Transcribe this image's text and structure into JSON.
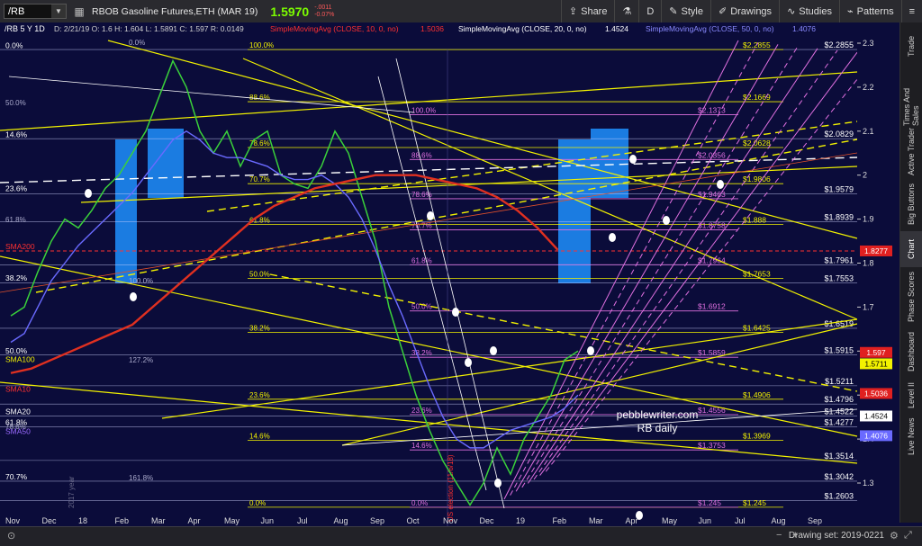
{
  "toolbar": {
    "symbol": "/RB",
    "instrument": "RBOB Gasoline Futures,ETH (MAR 19)",
    "price": "1.5970",
    "change_top": "-.0011",
    "change_bottom": "-0.07%",
    "share": "Share",
    "period": "D",
    "style": "Style",
    "drawings": "Drawings",
    "studies": "Studies",
    "patterns": "Patterns"
  },
  "chart": {
    "header_symbol": "/RB 5 Y 1D",
    "header_ohlc": "D: 2/21/19  O: 1.6  H: 1.604  L: 1.5891  C: 1.597  R: 0.0149",
    "sma10_label": "SimpleMovingAvg (CLOSE, 10, 0, no)",
    "sma10_val": "1.5036",
    "sma20_label": "SimpleMovingAvg (CLOSE, 20, 0, no)",
    "sma20_val": "1.4524",
    "sma50_label": "SimpleMovingAvg (CLOSE, 50, 0, no)",
    "sma50_val": "1.4076",
    "watermark_1": "pebblewriter.com",
    "watermark_2": "RB daily",
    "election": "US election (11/6/18)",
    "yr2017": "2017 year"
  },
  "y_axis": [
    "2.3",
    "2.2",
    "2.1",
    "2",
    "1.9",
    "1.8",
    "1.7",
    "1.6",
    "1.5",
    "1.4",
    "1.3"
  ],
  "x_axis": [
    "Nov",
    "Dec",
    "18",
    "Feb",
    "Mar",
    "Apr",
    "May",
    "Jun",
    "Jul",
    "Aug",
    "Sep",
    "Oct",
    "Nov",
    "Dec",
    "19",
    "Feb",
    "Mar",
    "Apr",
    "May",
    "Jun",
    "Jul",
    "Aug",
    "Sep"
  ],
  "price_tags": [
    {
      "label": "1.8277",
      "bg": "#e02020",
      "fg": "#ffffff",
      "y": 1.8277
    },
    {
      "label": "1.597",
      "bg": "#e02020",
      "fg": "#ffffff",
      "y": 1.597
    },
    {
      "label": "1.5711",
      "bg": "#f2f200",
      "fg": "#000000",
      "y": 1.5711
    },
    {
      "label": "1.5036",
      "bg": "#e02020",
      "fg": "#ffffff",
      "y": 1.5036
    },
    {
      "label": "1.4524",
      "bg": "#ffffff",
      "fg": "#000000",
      "y": 1.4524
    },
    {
      "label": "1.4076",
      "bg": "#6a6aff",
      "fg": "#ffffff",
      "y": 1.4076
    }
  ],
  "left_labels": [
    {
      "text": "0.0%",
      "color": "#ffffff",
      "y": 2.285
    },
    {
      "text": "14.6%",
      "color": "#ffffff",
      "y": 2.082
    },
    {
      "text": "23.6%",
      "color": "#ffffff",
      "y": 1.96
    },
    {
      "text": "SMA200",
      "color": "#ff3030",
      "y": 1.8277
    },
    {
      "text": "38.2%",
      "color": "#ffffff",
      "y": 1.756
    },
    {
      "text": "50.0%",
      "color": "#ffffff",
      "y": 1.59
    },
    {
      "text": "SMA100",
      "color": "#f2f200",
      "y": 1.5711
    },
    {
      "text": "SMA10",
      "color": "#ff3030",
      "y": 1.5036
    },
    {
      "text": "SMA20",
      "color": "#ffffff",
      "y": 1.4524
    },
    {
      "text": "61.8%",
      "color": "#ffffff",
      "y": 1.4277
    },
    {
      "text": "SMA50",
      "color": "#9a6aff",
      "y": 1.4076
    },
    {
      "text": "70.7%",
      "color": "#ffffff",
      "y": 1.3042
    }
  ],
  "fib_white": [
    {
      "pct": "0.0%",
      "val": "$2.2855",
      "y": 2.2855
    },
    {
      "pct": "14.6%",
      "val": "$2.0829",
      "y": 2.0829
    },
    {
      "pct": "23.6%",
      "val": "$1.9579",
      "y": 1.9579
    },
    {
      "pct": "",
      "val": "$1.8939",
      "y": 1.8939
    },
    {
      "pct": "",
      "val": "$1.7961",
      "y": 1.7961
    },
    {
      "pct": "",
      "val": "$1.7553",
      "y": 1.7553
    },
    {
      "pct": "",
      "val": "$1.6519",
      "y": 1.6519
    },
    {
      "pct": "",
      "val": "$1.5915",
      "y": 1.5915
    },
    {
      "pct": "",
      "val": "$1.5211",
      "y": 1.5211
    },
    {
      "pct": "",
      "val": "$1.4796",
      "y": 1.4796
    },
    {
      "pct": "",
      "val": "$1.4522",
      "y": 1.4522
    },
    {
      "pct": "",
      "val": "$1.4277",
      "y": 1.4277
    },
    {
      "pct": "",
      "val": "$1.3514",
      "y": 1.3514
    },
    {
      "pct": "",
      "val": "$1.3042",
      "y": 1.3042
    },
    {
      "pct": "",
      "val": "$1.2603",
      "y": 1.2603
    }
  ],
  "fib_yellow": [
    {
      "pct": "100.0%",
      "val": "$2.2855",
      "y": 2.2855
    },
    {
      "pct": "88.6%",
      "val": "$2.1669",
      "y": 2.1669
    },
    {
      "pct": "78.6%",
      "val": "$2.0628",
      "y": 2.0628
    },
    {
      "pct": "70.7%",
      "val": "$1.9806",
      "y": 1.9806
    },
    {
      "pct": "61.8%",
      "val": "$1.888",
      "y": 1.888
    },
    {
      "pct": "50.0%",
      "val": "$1.7653",
      "y": 1.7653
    },
    {
      "pct": "38.2%",
      "val": "$1.6425",
      "y": 1.6425
    },
    {
      "pct": "23.6%",
      "val": "$1.4906",
      "y": 1.4906
    },
    {
      "pct": "14.6%",
      "val": "$1.3969",
      "y": 1.3969
    },
    {
      "pct": "0.0%",
      "val": "$1.245",
      "y": 1.245
    }
  ],
  "fib_magenta": [
    {
      "pct": "100.0%",
      "val": "$2.1373",
      "y": 2.1373
    },
    {
      "pct": "88.6%",
      "val": "$2.0356",
      "y": 2.0356
    },
    {
      "pct": "78.6%",
      "val": "$1.9463",
      "y": 1.9463
    },
    {
      "pct": "70.7%",
      "val": "$1.8758",
      "y": 1.8758
    },
    {
      "pct": "61.8%",
      "val": "$1.7964",
      "y": 1.7964
    },
    {
      "pct": "50.0%",
      "val": "$1.6912",
      "y": 1.6912
    },
    {
      "pct": "38.2%",
      "val": "$1.5859",
      "y": 1.5859
    },
    {
      "pct": "23.6%",
      "val": "$1.4556",
      "y": 1.4556
    },
    {
      "pct": "14.6%",
      "val": "$1.3753",
      "y": 1.3753
    },
    {
      "pct": "0.0%",
      "val": "$1.245",
      "y": 1.245
    }
  ],
  "extra_texts": {
    "l50": "50.0%",
    "l618": "61.8%",
    "l786": "78.6%",
    "l1272": "127.2%",
    "l1618": "161.8%",
    "l1000": "100.0%"
  },
  "right_tabs": [
    "Trade",
    "Times And Sales",
    "Active Trader",
    "Big Buttons",
    "Chart",
    "Phase Scores",
    "Dashboard",
    "Level II",
    "Live News"
  ],
  "status": {
    "drawing_set": "Drawing set: 2019-0221"
  },
  "colors": {
    "bg": "#0b0c3a",
    "yellow": "#f2f200",
    "magenta": "#e070e0",
    "red": "#e03020",
    "blue_box": "#1e90ff",
    "white": "#ffffff",
    "sma50": "#6a6aff"
  }
}
